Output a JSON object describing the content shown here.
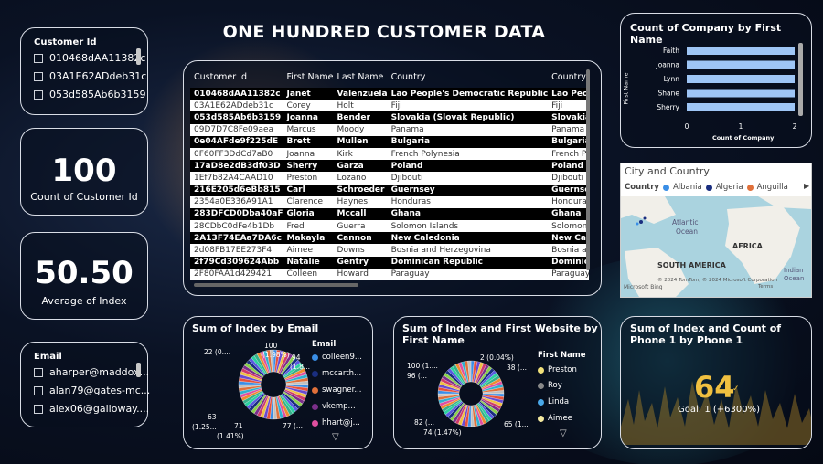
{
  "title": "ONE HUNDRED CUSTOMER DATA",
  "customer_slicer": {
    "title": "Customer Id",
    "items": [
      "010468dAA11382c",
      "03A1E62ADdeb31c",
      "053d585Ab6b3159"
    ]
  },
  "kpi_count": {
    "value": "100",
    "label": "Count of Customer Id"
  },
  "kpi_avg": {
    "value": "50.50",
    "label": "Average of Index"
  },
  "email_slicer": {
    "title": "Email",
    "items": [
      "aharper@maddox...",
      "alan79@gates-mc...",
      "alex06@galloway...."
    ]
  },
  "table": {
    "headers": [
      "Customer Id",
      "First Name",
      "Last Name",
      "Country",
      "Country"
    ],
    "rows": [
      [
        "010468dAA11382c",
        "Janet",
        "Valenzuela",
        "Lao People's Democratic Republic",
        "Lao People"
      ],
      [
        "03A1E62ADdeb31c",
        "Corey",
        "Holt",
        "Fiji",
        "Fiji"
      ],
      [
        "053d585Ab6b3159",
        "Joanna",
        "Bender",
        "Slovakia (Slovak Republic)",
        "Slovakia"
      ],
      [
        "09D7D7C8Fe09aea",
        "Marcus",
        "Moody",
        "Panama",
        "Panama"
      ],
      [
        "0e04AFde9f225dE",
        "Brett",
        "Mullen",
        "Bulgaria",
        "Bulgaria"
      ],
      [
        "0F60FF3DdCd7aB0",
        "Joanna",
        "Kirk",
        "French Polynesia",
        "French P"
      ],
      [
        "17aD8e2dB3df03D",
        "Sherry",
        "Garza",
        "Poland",
        "Poland"
      ],
      [
        "1Ef7b82A4CAAD10",
        "Preston",
        "Lozano",
        "Djibouti",
        "Djibouti"
      ],
      [
        "216E205d6eBb815",
        "Carl",
        "Schroeder",
        "Guernsey",
        "Guernsey"
      ],
      [
        "2354a0E336A91A1",
        "Clarence",
        "Haynes",
        "Honduras",
        "Hondura"
      ],
      [
        "283DFCD0Dba40aF",
        "Gloria",
        "Mccall",
        "Ghana",
        "Ghana"
      ],
      [
        "28CDbC0dFe4b1Db",
        "Fred",
        "Guerra",
        "Solomon Islands",
        "Solomon"
      ],
      [
        "2A13F74EAa7DA6c",
        "Makayla",
        "Cannon",
        "New Caledonia",
        "New Cale"
      ],
      [
        "2d08FB17EE273F4",
        "Aimee",
        "Downs",
        "Bosnia and Herzegovina",
        "Bosnia a"
      ],
      [
        "2f79Cd309624Abb",
        "Natalie",
        "Gentry",
        "Dominican Republic",
        "Dominica"
      ],
      [
        "2F80FAA1d429421",
        "Colleen",
        "Howard",
        "Paraguay",
        "Paraguay"
      ]
    ]
  },
  "bar_chart": {
    "title": "Count of Company by First Name",
    "ylabel": "First Name",
    "xlabel": "Count of Company",
    "ticks": [
      "0",
      "1",
      "2"
    ],
    "color": "#9ec5f5"
  },
  "chart_data": [
    {
      "type": "bar",
      "title": "Count of Company by First Name",
      "categories": [
        "Faith",
        "Joanna",
        "Lynn",
        "Shane",
        "Sherry"
      ],
      "values": [
        2,
        2,
        2,
        2,
        2
      ],
      "xlabel": "Count of Company",
      "ylabel": "First Name",
      "xlim": [
        0,
        2
      ]
    },
    {
      "type": "pie",
      "title": "Sum of Index by Email",
      "legend_title": "Email",
      "legend": [
        "colleen9...",
        "mccarth...",
        "swagner...",
        "vkemp...",
        "hhart@j..."
      ],
      "labels": [
        "100",
        "(1.98%)",
        "94",
        "(1.8...",
        "22 (0....",
        "63",
        "(1.25...",
        "71",
        "(1.41%)",
        "77 (..."
      ]
    },
    {
      "type": "pie",
      "title": "Sum of Index and First Website by First Name",
      "legend_title": "First Name",
      "legend": [
        "Preston",
        "Roy",
        "Linda",
        "Aimee"
      ],
      "labels": [
        "2 (0.04%)",
        "38 (...",
        "100 (1....",
        "96 (...",
        "82 (...",
        "74 (1.47%)",
        "65 (1..."
      ]
    }
  ],
  "map": {
    "title": "City and Country",
    "legend_label": "Country",
    "legend": [
      {
        "name": "Albania",
        "color": "#3a8ee6"
      },
      {
        "name": "Algeria",
        "color": "#1a2e80"
      },
      {
        "name": "Anguilla",
        "color": "#e0703a"
      }
    ],
    "labels": {
      "ocean": "Atlantic",
      "ocean2": "Ocean",
      "africa": "AFRICA",
      "samerica": "SOUTH AMERICA",
      "indian": "Indian",
      "indian2": "Ocean"
    },
    "credit": "© 2024 TomTom, © 2024 Microsoft Corporation",
    "terms": "Terms",
    "brand": "Microsoft Bing"
  },
  "pie1": {
    "title": "Sum of Index by Email",
    "legend_title": "Email",
    "legend": [
      {
        "label": "colleen9...",
        "color": "#3a8ee6"
      },
      {
        "label": "mccarth...",
        "color": "#1a2e80"
      },
      {
        "label": "swagner...",
        "color": "#e0703a"
      },
      {
        "label": "vkemp...",
        "color": "#7b2f8a"
      },
      {
        "label": "hhart@j...",
        "color": "#e04fa0"
      }
    ],
    "labels": {
      "l100": "100",
      "l198": "(1.98%)",
      "l94": "94",
      "l18": "(1.8...",
      "l22": "22 (0....",
      "l63": "63",
      "l125": "(1.25...",
      "l71": "71",
      "l141": "(1.41%)",
      "l77": "77 (..."
    }
  },
  "pie2": {
    "title": "Sum of Index and First Website by First Name",
    "legend_title": "First Name",
    "legend": [
      {
        "label": "Preston",
        "color": "#f0e07a"
      },
      {
        "label": "Roy",
        "color": "#888888"
      },
      {
        "label": "Linda",
        "color": "#4aa8e8"
      },
      {
        "label": "Aimee",
        "color": "#f4e9a0"
      }
    ],
    "labels": {
      "l2": "2 (0.04%)",
      "l38": "38 (...",
      "l100": "100 (1....",
      "l96": "96 (...",
      "l82": "82 (...",
      "l74": "74 (1.47%)",
      "l65": "65 (1..."
    }
  },
  "gauge": {
    "title": "Sum of Index and Count of Phone 1 by Phone 1",
    "value": "64",
    "goal": "Goal: 1 (+6300%)",
    "color": "#f0c040"
  },
  "colors": {
    "slice": [
      "#3a8ee6",
      "#1a2e80",
      "#e0703a",
      "#7b2f8a",
      "#e04fa0",
      "#f0c040",
      "#35b08a",
      "#e8503a",
      "#5a5ae0",
      "#c0c0c0",
      "#8ad04a",
      "#30b0d0",
      "#d03a6a",
      "#f08a30",
      "#6a4ad0",
      "#2ad0a0"
    ]
  }
}
